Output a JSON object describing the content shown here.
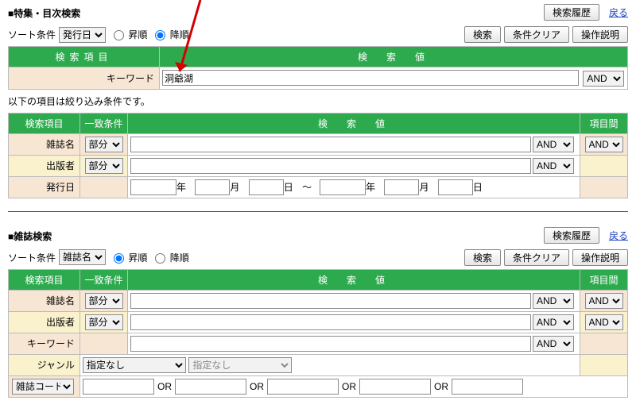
{
  "s1": {
    "title": "■特集・目次検索",
    "history_btn": "検索履歴",
    "back": "戻る",
    "sort_label": "ソート条件",
    "sort_field": "発行日",
    "asc": "昇順",
    "desc": "降順",
    "search_btn": "検索",
    "clear_btn": "条件クリア",
    "help_btn": "操作説明",
    "hdr_item": "検索項目",
    "hdr_value": "検　索　値",
    "kw_label": "キーワード",
    "kw_value": "洞爺湖",
    "kw_op": "AND",
    "note": "以下の項目は絞り込み条件です。",
    "hdr_match": "一致条件",
    "hdr_between": "項目間",
    "rows": {
      "mag": {
        "label": "雑誌名",
        "match": "部分",
        "op": "AND",
        "between": "AND"
      },
      "pub": {
        "label": "出版者",
        "match": "部分",
        "op": "AND"
      },
      "date": {
        "label": "発行日",
        "y": "年",
        "m": "月",
        "d": "日",
        "sep": "～"
      }
    }
  },
  "s2": {
    "title": "■雑誌検索",
    "sort_field": "雑誌名",
    "hdr_item": "検索項目",
    "hdr_match": "一致条件",
    "hdr_value": "検　索　値",
    "hdr_between": "項目間",
    "rows": {
      "mag": {
        "label": "雑誌名",
        "match": "部分",
        "op": "AND",
        "between": "AND"
      },
      "pub": {
        "label": "出版者",
        "match": "部分",
        "op": "AND",
        "between": "AND"
      },
      "kw": {
        "label": "キーワード",
        "op": "AND"
      },
      "genre": {
        "label": "ジャンル",
        "sel1": "指定なし",
        "sel2": "指定なし"
      },
      "code": {
        "label": "雑誌コード",
        "or": "OR"
      }
    }
  }
}
